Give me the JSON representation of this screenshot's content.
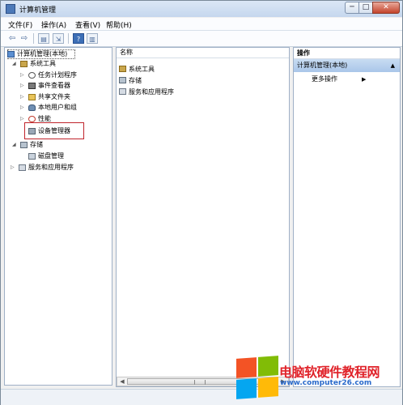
{
  "window": {
    "title": "计算机管理"
  },
  "menubar": {
    "items": [
      "文件(F)",
      "操作(A)",
      "查看(V)",
      "帮助(H)"
    ]
  },
  "tree": {
    "root": "计算机管理(本地)",
    "system_tools": "系统工具",
    "task_scheduler": "任务计划程序",
    "event_viewer": "事件查看器",
    "shared_folders": "共享文件夹",
    "local_users": "本地用户和组",
    "performance": "性能",
    "device_manager": "设备管理器",
    "storage": "存储",
    "disk_management": "磁盘管理",
    "services_apps": "服务和应用程序"
  },
  "list": {
    "header": "名称",
    "items": [
      "系统工具",
      "存储",
      "服务和应用程序"
    ]
  },
  "actions": {
    "header": "操作",
    "section": "计算机管理(本地)",
    "more": "更多操作"
  },
  "watermark": {
    "line1": "电脑软硬件教程网",
    "line2": "www.computer26.com"
  },
  "colors": {
    "selection_highlight": "#c0242c",
    "actions_section_bg": "#b8d2ee",
    "watermark_red": "#e0232a",
    "watermark_blue": "#2a6acb"
  },
  "icons": {
    "back": "arrow-left-icon",
    "forward": "arrow-right-icon",
    "close": "close-icon"
  }
}
